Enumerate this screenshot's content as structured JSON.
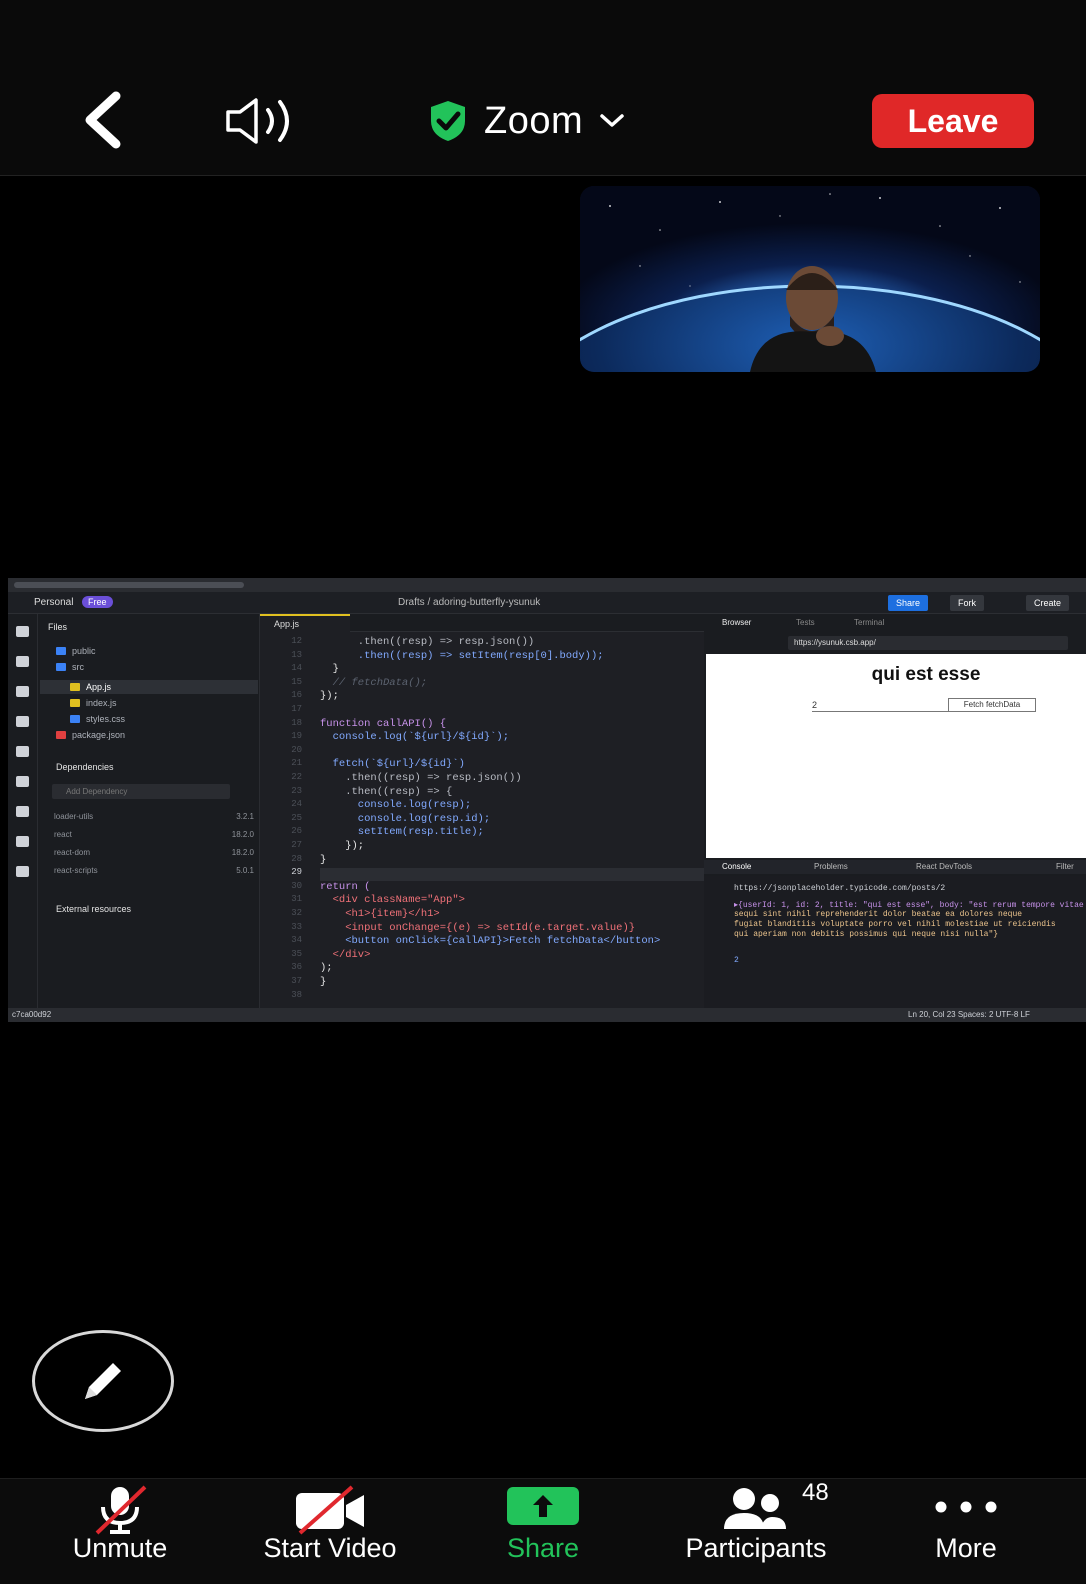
{
  "header": {
    "title": "Zoom",
    "leave_label": "Leave"
  },
  "shared_screen": {
    "appbar": {
      "workspace": "Personal",
      "plan_badge": "Free",
      "breadcrumb": "Drafts / adoring-butterfly-ysunuk",
      "share_label": "Share",
      "fork_label": "Fork",
      "create_label": "Create"
    },
    "files_panel": {
      "heading": "Files",
      "tree": [
        {
          "name": "public",
          "color": "#3b82f6"
        },
        {
          "name": "src",
          "color": "#3b82f6"
        },
        {
          "name": "App.js",
          "color": "#e0c020"
        },
        {
          "name": "index.js",
          "color": "#e0c020"
        },
        {
          "name": "styles.css",
          "color": "#3b82f6"
        },
        {
          "name": "package.json",
          "color": "#e04040"
        }
      ],
      "dependencies_heading": "Dependencies",
      "add_dependency_placeholder": "Add Dependency",
      "dependencies": [
        {
          "name": "loader-utils",
          "version": "3.2.1"
        },
        {
          "name": "react",
          "version": "18.2.0"
        },
        {
          "name": "react-dom",
          "version": "18.2.0"
        },
        {
          "name": "react-scripts",
          "version": "5.0.1"
        }
      ],
      "external_heading": "External resources"
    },
    "editor": {
      "tab_label": "App.js",
      "line_numbers": [
        "12",
        "13",
        "14",
        "15",
        "16",
        "17",
        "18",
        "19",
        "20",
        "21",
        "22",
        "23",
        "24",
        "25",
        "26",
        "27",
        "28",
        "29",
        "30",
        "31",
        "32",
        "33",
        "34",
        "35",
        "36",
        "37",
        "38"
      ],
      "lines": [
        "      .then((resp) => resp.json())",
        "      .then((resp) => setItem(resp[0].body));",
        "  }",
        "  // fetchData();",
        "});",
        "",
        "function callAPI() {",
        "  console.log(`${url}/${id}`);",
        "",
        "  fetch(`${url}/${id}`)",
        "    .then((resp) => resp.json())",
        "    .then((resp) => {",
        "      console.log(resp);",
        "      console.log(resp.id);",
        "      setItem(resp.title);",
        "    });",
        "}",
        "",
        "return (",
        "  <div className=\"App\">",
        "    <h1>{item}</h1>",
        "    <input onChange={(e) => setId(e.target.value)}",
        "    <button onClick={callAPI}>Fetch fetchData</button>",
        "  </div>",
        ");",
        "}",
        ""
      ]
    },
    "browser": {
      "tabs": [
        "Browser",
        "Tests",
        "Terminal"
      ],
      "url": "https://ysunuk.csb.app/",
      "preview_title": "qui est esse",
      "input_value": "2",
      "button_label": "Fetch fetchData",
      "console_tabs": [
        "Console",
        "Problems",
        "React DevTools"
      ],
      "filter_label": "Filter",
      "console_lines": [
        "https://jsonplaceholder.typicode.com/posts/2",
        "▸{userId: 1, id: 2, title: \"qui est esse\", body: \"est rerum tempore vitae",
        "sequi sint nihil reprehenderit dolor beatae ea dolores neque",
        "fugiat blanditiis voluptate porro vel nihil molestiae ut reiciendis",
        "qui aperiam non debitis possimus qui neque nisi nulla\"}",
        "2"
      ]
    },
    "statusbar": {
      "left": "c7ca00d92",
      "right": "Ln 20, Col 23   Spaces: 2   UTF-8   LF"
    }
  },
  "toolbar": {
    "unmute_label": "Unmute",
    "start_video_label": "Start Video",
    "share_label": "Share",
    "participants_label": "Participants",
    "participants_count": "48",
    "more_label": "More"
  },
  "colors": {
    "leave": "#e02828",
    "share_green": "#22c35a",
    "shield_green": "#22c35a"
  },
  "icons": [
    "back-chevron-icon",
    "speaker-icon",
    "shield-check-icon",
    "chevron-down-icon",
    "pencil-icon",
    "mic-muted-icon",
    "video-muted-icon",
    "share-arrow-icon",
    "participants-icon",
    "more-dots-icon"
  ]
}
